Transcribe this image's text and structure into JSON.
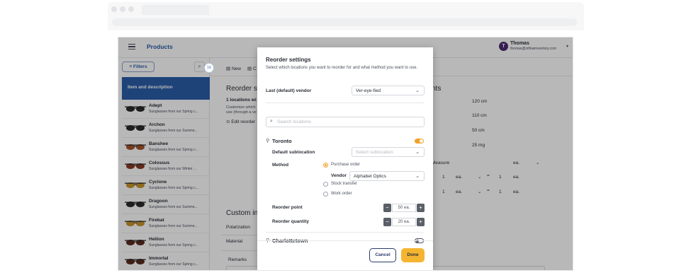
{
  "header": {
    "page_title": "Products",
    "user_initial": "T",
    "user_name": "Thomas",
    "user_email": "thomas@inflowinventory.com"
  },
  "sidebar": {
    "filters_label": "Filters",
    "list_header": "Item and description",
    "items": [
      {
        "name": "Adept",
        "desc": "Sunglasses from our Spring c..."
      },
      {
        "name": "Archon",
        "desc": "Sunglasses from our Summe..."
      },
      {
        "name": "Banshee",
        "desc": "Sunglasses from our Spring c..."
      },
      {
        "name": "Colossus",
        "desc": "Sunglasses from our Winter ..."
      },
      {
        "name": "Cyclone",
        "desc": "Sunglasses from our Spring c..."
      },
      {
        "name": "Dragoon",
        "desc": "Sunglasses from our Summe..."
      },
      {
        "name": "Firebat",
        "desc": "Sunglasses from our Summe..."
      },
      {
        "name": "Hellion",
        "desc": "Sunglasses from our Spring c..."
      },
      {
        "name": "Immortal",
        "desc": "Sunglasses from our Spring c..."
      }
    ]
  },
  "main": {
    "toolbar_new": "New",
    "toolbar_second": "C",
    "reorder_heading": "Reorder se",
    "locations_text": "1 locations wi",
    "customize_line1": "Customize which",
    "customize_line2": "use (through a ve",
    "edit_reorder": "Edit reorder",
    "measurements_heading": "nts",
    "measurements": [
      "120 cm",
      "110 cm",
      "50 cm",
      "25 mg"
    ],
    "measure_col": "Measure",
    "unit_ea": "ea.",
    "qty_one": "1",
    "times_sign": "=",
    "custom_heading": "Custom in",
    "custom_fields": [
      "Polarization",
      "Material"
    ],
    "remarks_label": "Remarks"
  },
  "modal": {
    "title": "Reorder settings",
    "description": "Select which locations you want to reorder for and what method you want to use.",
    "last_vendor_label": "Last (default) vendor",
    "last_vendor_value": "Ver-eye-fied",
    "search_placeholder": "Search locations",
    "locations": [
      {
        "name": "Toronto",
        "enabled": true,
        "default_sublocation_label": "Default sublocation",
        "default_sublocation_placeholder": "Select sublocation",
        "method_label": "Method",
        "methods": [
          "Purchase order",
          "Stock transfer",
          "Work order"
        ],
        "selected_method": "Purchase order",
        "vendor_label": "Vendor",
        "vendor_value": "Alphabet Optics",
        "reorder_point_label": "Reorder point",
        "reorder_point_value": "50 ea.",
        "reorder_quantity_label": "Reorder quantity",
        "reorder_quantity_value": "20 ea."
      },
      {
        "name": "Charlottetown",
        "enabled": false
      }
    ],
    "cancel_label": "Cancel",
    "done_label": "Done"
  },
  "colors": {
    "brand_blue": "#2a5ea8",
    "accent_orange": "#f2a12a",
    "done_yellow": "#f5b531",
    "avatar_purple": "#4b2a74"
  }
}
